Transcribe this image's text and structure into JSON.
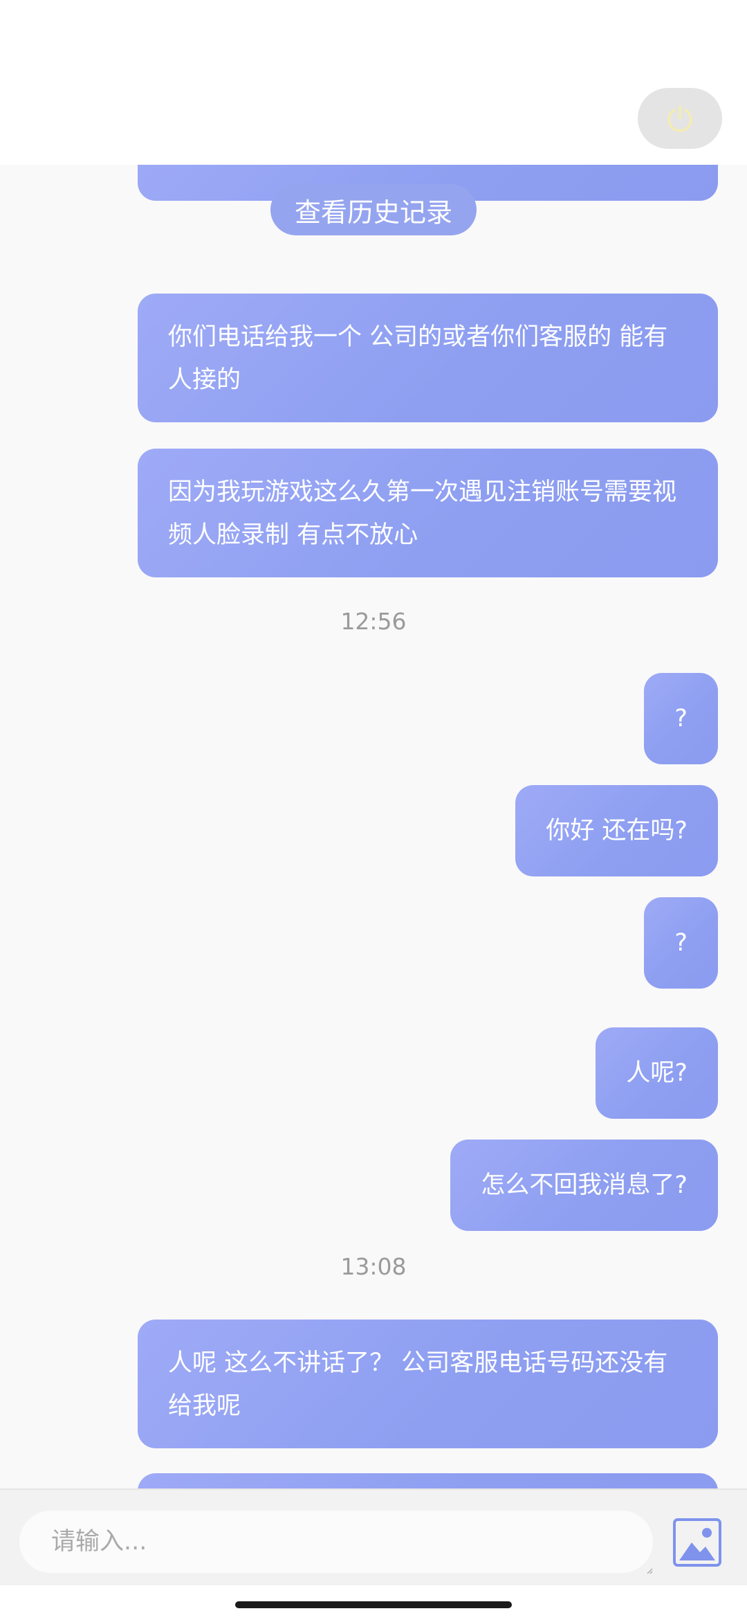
{
  "header": {
    "power_icon": "power-icon",
    "power_icon_color": "#f3ecb2"
  },
  "chat": {
    "history_button": "查看历史记录",
    "messages": [
      {
        "text": "你们电话给我一个 公司的或者你们客服的 能有人接的"
      },
      {
        "text": "因为我玩游戏这么久第一次遇见注销账号需要视频人脸录制 有点不放心"
      },
      {
        "time": "12:56"
      },
      {
        "text": "?"
      },
      {
        "text": "你好 还在吗?"
      },
      {
        "text": "?"
      },
      {
        "text": "人呢?"
      },
      {
        "text": "怎么不回我消息了?"
      },
      {
        "time": "13:08"
      },
      {
        "text": "人呢 这么不讲话了？ 公司客服电话号码还没有给我呢"
      }
    ]
  },
  "input": {
    "placeholder": "请输入...",
    "value": "",
    "image_icon": "image-icon"
  },
  "colors": {
    "bubble": "#919ff2",
    "history_button": "#95a4ef",
    "timestamp": "#9a9a9a",
    "icon_accent": "#7f93ec"
  }
}
